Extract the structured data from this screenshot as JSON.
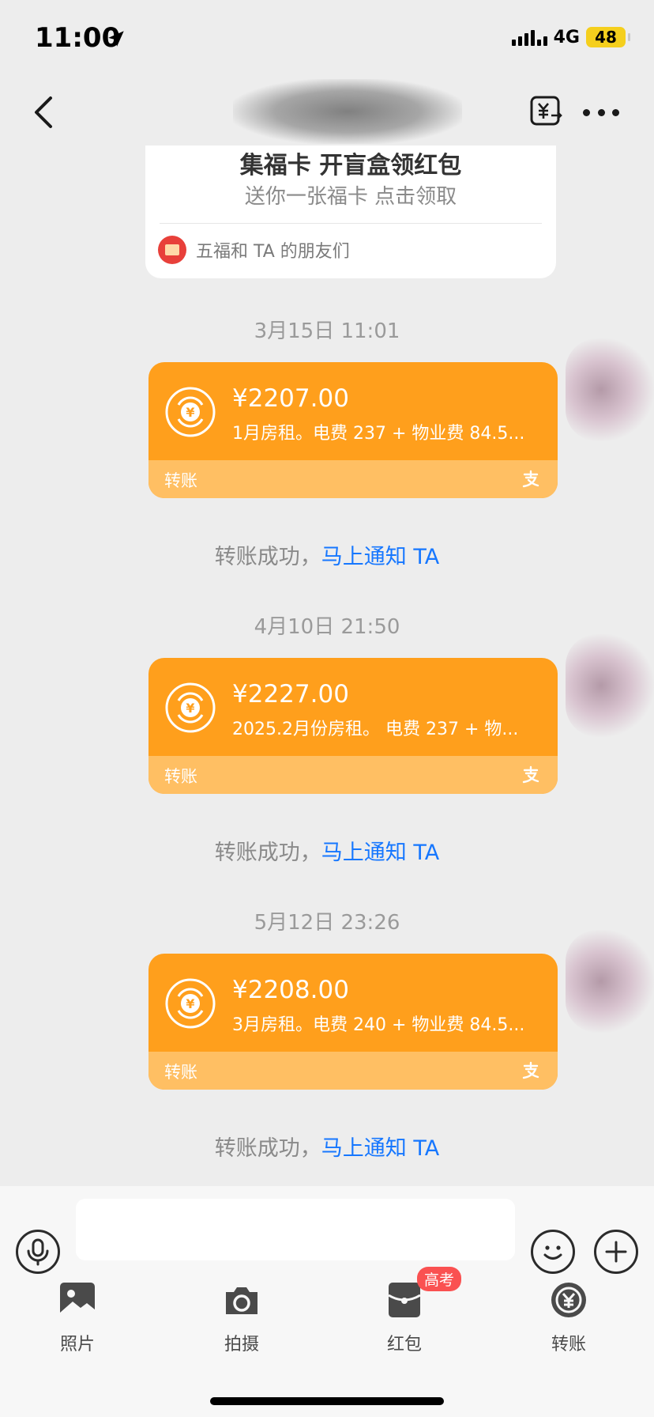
{
  "status": {
    "time": "11:00",
    "network": "4G",
    "battery": "48"
  },
  "header": {
    "title": ""
  },
  "fu_card": {
    "title": "集福卡 开盲盒领红包",
    "subtitle": "送你一张福卡 点击领取",
    "source": "五福和 TA 的朋友们"
  },
  "messages": [
    {
      "timestamp": "3月15日 11:01",
      "amount": "¥2207.00",
      "memo": "1月房租。电费 237 + 物业费 84.5...",
      "label": "转账",
      "notice_text": "转账成功，",
      "notice_link": "马上通知 TA"
    },
    {
      "timestamp": "4月10日 21:50",
      "amount": "¥2227.00",
      "memo": "2025.2月份房租。 电费 237 + 物...",
      "label": "转账",
      "notice_text": "转账成功，",
      "notice_link": "马上通知 TA"
    },
    {
      "timestamp": "5月12日 23:26",
      "amount": "¥2208.00",
      "memo": "3月房租。电费 240 + 物业费 84.5...",
      "label": "转账",
      "notice_text": "转账成功，",
      "notice_link": "马上通知 TA"
    }
  ],
  "toolbar": {
    "items": [
      {
        "label": "照片",
        "icon": "photo-icon"
      },
      {
        "label": "拍摄",
        "icon": "camera-icon"
      },
      {
        "label": "红包",
        "icon": "red-packet-icon",
        "badge": "高考"
      },
      {
        "label": "转账",
        "icon": "transfer-icon"
      }
    ]
  },
  "colors": {
    "bubble": "#ff9f1c",
    "bubble_footer": "#ffbf63",
    "link": "#1677ff",
    "badge": "#fa5151"
  }
}
